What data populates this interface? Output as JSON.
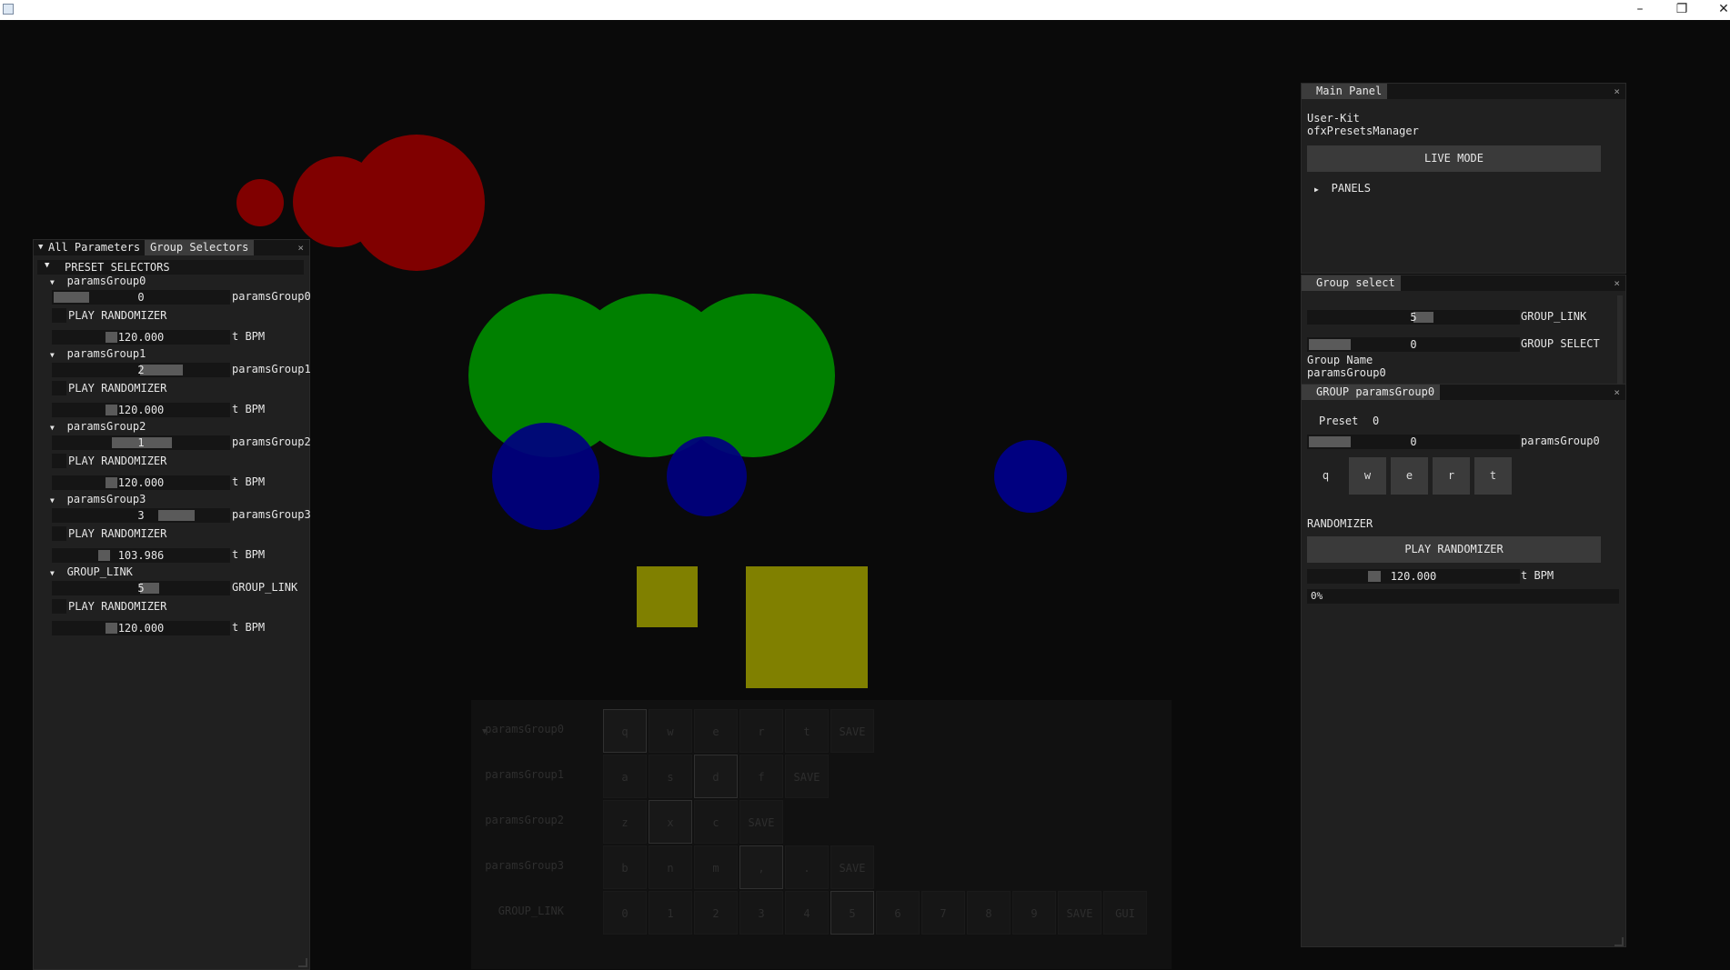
{
  "window": {
    "minimize": "–",
    "restore": "❐",
    "close": "✕"
  },
  "colors": {
    "red": "#800000",
    "green": "#008000",
    "blue": "#000080",
    "olive": "#808000"
  },
  "main_panel": {
    "title": "Main Panel",
    "line1": "User-Kit",
    "line2": "ofxPresetsManager",
    "live_mode": "LIVE MODE",
    "panels": "PANELS"
  },
  "group_select": {
    "title": "Group select",
    "link_value": "5",
    "link_label": "GROUP_LINK",
    "select_value": "0",
    "select_label": "GROUP SELECT",
    "group_name_label": "Group Name",
    "group_name_value": "paramsGroup0"
  },
  "group_panel": {
    "title": "GROUP paramsGroup0",
    "preset_label": "Preset",
    "preset_value": "0",
    "slider_value": "0",
    "slider_label": "paramsGroup0",
    "keys": [
      "q",
      "w",
      "e",
      "r",
      "t"
    ],
    "randomizer_label": "RANDOMIZER",
    "play_randomizer": "PLAY RANDOMIZER",
    "bpm_value": "120.000",
    "bpm_label": "t BPM",
    "progress": "0%"
  },
  "left_panel": {
    "tab1": "All Parameters",
    "tab2": "Group Selectors",
    "header": "PRESET SELECTORS",
    "groups": [
      {
        "name": "paramsGroup0",
        "value": "0",
        "label": "paramsGroup0",
        "play": "PLAY RANDOMIZER",
        "bpm": "120.000",
        "bpm_label": "t BPM"
      },
      {
        "name": "paramsGroup1",
        "value": "2",
        "label": "paramsGroup1",
        "play": "PLAY RANDOMIZER",
        "bpm": "120.000",
        "bpm_label": "t BPM"
      },
      {
        "name": "paramsGroup2",
        "value": "1",
        "label": "paramsGroup2",
        "play": "PLAY RANDOMIZER",
        "bpm": "120.000",
        "bpm_label": "t BPM"
      },
      {
        "name": "paramsGroup3",
        "value": "3",
        "label": "paramsGroup3",
        "play": "PLAY RANDOMIZER",
        "bpm": "103.986",
        "bpm_label": "t BPM"
      },
      {
        "name": "GROUP_LINK",
        "value": "5",
        "label": "GROUP_LINK",
        "play": "PLAY RANDOMIZER",
        "bpm": "120.000",
        "bpm_label": "t BPM"
      }
    ]
  },
  "keys_panel": {
    "rows": [
      {
        "label": "paramsGroup0",
        "keys": [
          "q",
          "w",
          "e",
          "r",
          "t",
          "SAVE"
        ]
      },
      {
        "label": "paramsGroup1",
        "keys": [
          "a",
          "s",
          "d",
          "f",
          "SAVE"
        ]
      },
      {
        "label": "paramsGroup2",
        "keys": [
          "z",
          "x",
          "c",
          "SAVE"
        ]
      },
      {
        "label": "paramsGroup3",
        "keys": [
          "b",
          "n",
          "m",
          ",",
          ".",
          "SAVE"
        ]
      },
      {
        "label": "GROUP_LINK",
        "keys": [
          "0",
          "1",
          "2",
          "3",
          "4",
          "5",
          "6",
          "7",
          "8",
          "9",
          "SAVE",
          "GUI"
        ]
      }
    ]
  }
}
